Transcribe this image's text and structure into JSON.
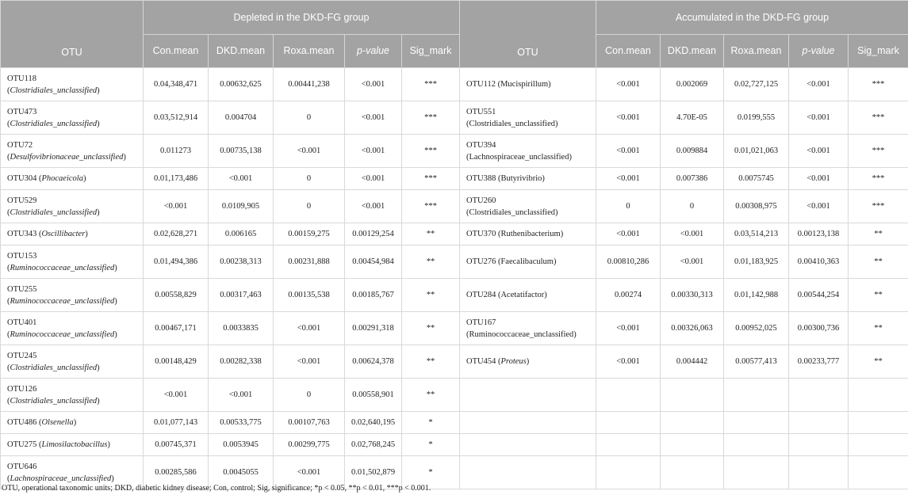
{
  "header": {
    "group_left": "Depleted in the DKD-FG group",
    "group_right": "Accumulated in the DKD-FG group",
    "columns": [
      "OTU",
      "Con.mean",
      "DKD.mean",
      "Roxa.mean",
      "p-value",
      "Sig_mark"
    ]
  },
  "rows": [
    {
      "tall": true,
      "left": {
        "id": "OTU118",
        "tax": "Clostridiales_unclassified",
        "italic": true,
        "wrap": true,
        "con": "0.04,348,471",
        "dkd": "0.00632,625",
        "roxa": "0.00441,238",
        "p": "<0.001",
        "sig": "***"
      },
      "right": {
        "id": "OTU112",
        "tax": "Mucispirillum",
        "italic": false,
        "wrap": false,
        "con": "<0.001",
        "dkd": "0.002069",
        "roxa": "0.02,727,125",
        "p": "<0.001",
        "sig": "***"
      }
    },
    {
      "tall": true,
      "left": {
        "id": "OTU473",
        "tax": "Clostridiales_unclassified",
        "italic": true,
        "wrap": true,
        "con": "0.03,512,914",
        "dkd": "0.004704",
        "roxa": "0",
        "p": "<0.001",
        "sig": "***"
      },
      "right": {
        "id": "OTU551",
        "tax": "Clostridiales_unclassified",
        "italic": false,
        "wrap": true,
        "con": "<0.001",
        "dkd": "4.70E-05",
        "roxa": "0.0199,555",
        "p": "<0.001",
        "sig": "***"
      }
    },
    {
      "tall": true,
      "left": {
        "id": "OTU72",
        "tax": "Desulfovibrionaceae_unclassified",
        "italic": true,
        "wrap": true,
        "con": "0.011273",
        "dkd": "0.00735,138",
        "roxa": "<0.001",
        "p": "<0.001",
        "sig": "***"
      },
      "right": {
        "id": "OTU394",
        "tax": "Lachnospiraceae_unclassified",
        "italic": false,
        "wrap": true,
        "con": "<0.001",
        "dkd": "0.009884",
        "roxa": "0.01,021,063",
        "p": "<0.001",
        "sig": "***"
      }
    },
    {
      "tall": false,
      "left": {
        "id": "OTU304",
        "tax": "Phocaeicola",
        "italic": true,
        "wrap": false,
        "con": "0.01,173,486",
        "dkd": "<0.001",
        "roxa": "0",
        "p": "<0.001",
        "sig": "***"
      },
      "right": {
        "id": "OTU388",
        "tax": "Butyrivibrio",
        "italic": false,
        "wrap": false,
        "con": "<0.001",
        "dkd": "0.007386",
        "roxa": "0.0075745",
        "p": "<0.001",
        "sig": "***"
      }
    },
    {
      "tall": true,
      "left": {
        "id": "OTU529",
        "tax": "Clostridiales_unclassified",
        "italic": true,
        "wrap": true,
        "con": "<0.001",
        "dkd": "0.0109,905",
        "roxa": "0",
        "p": "<0.001",
        "sig": "***"
      },
      "right": {
        "id": "OTU260",
        "tax": "Clostridiales_unclassified",
        "italic": false,
        "wrap": true,
        "con": "0",
        "dkd": "0",
        "roxa": "0.00308,975",
        "p": "<0.001",
        "sig": "***"
      }
    },
    {
      "tall": false,
      "left": {
        "id": "OTU343",
        "tax": "Oscillibacter",
        "italic": true,
        "wrap": false,
        "con": "0.02,628,271",
        "dkd": "0.006165",
        "roxa": "0.00159,275",
        "p": "0.00129,254",
        "sig": "**"
      },
      "right": {
        "id": "OTU370",
        "tax": "Ruthenibacterium",
        "italic": false,
        "wrap": false,
        "con": "<0.001",
        "dkd": "<0.001",
        "roxa": "0.03,514,213",
        "p": "0.00123,138",
        "sig": "**"
      }
    },
    {
      "tall": true,
      "left": {
        "id": "OTU153",
        "tax": "Ruminococcaceae_unclassified",
        "italic": true,
        "wrap": true,
        "con": "0.01,494,386",
        "dkd": "0.00238,313",
        "roxa": "0.00231,888",
        "p": "0.00454,984",
        "sig": "**"
      },
      "right": {
        "id": "OTU276",
        "tax": "Faecalibaculum",
        "italic": false,
        "wrap": false,
        "con": "0.00810,286",
        "dkd": "<0.001",
        "roxa": "0.01,183,925",
        "p": "0.00410,363",
        "sig": "**"
      }
    },
    {
      "tall": true,
      "left": {
        "id": "OTU255",
        "tax": "Ruminococcaceae_unclassified",
        "italic": true,
        "wrap": true,
        "con": "0.00558,829",
        "dkd": "0.00317,463",
        "roxa": "0.00135,538",
        "p": "0.00185,767",
        "sig": "**"
      },
      "right": {
        "id": "OTU284",
        "tax": "Acetatifactor",
        "italic": false,
        "wrap": false,
        "con": "0.00274",
        "dkd": "0.00330,313",
        "roxa": "0.01,142,988",
        "p": "0.00544,254",
        "sig": "**"
      }
    },
    {
      "tall": true,
      "left": {
        "id": "OTU401",
        "tax": "Ruminococcaceae_unclassified",
        "italic": true,
        "wrap": true,
        "con": "0.00467,171",
        "dkd": "0.0033835",
        "roxa": "<0.001",
        "p": "0.00291,318",
        "sig": "**"
      },
      "right": {
        "id": "OTU167",
        "tax": "Ruminococcaceae_unclassified",
        "italic": false,
        "wrap": true,
        "con": "<0.001",
        "dkd": "0.00326,063",
        "roxa": "0.00952,025",
        "p": "0.00300,736",
        "sig": "**"
      }
    },
    {
      "tall": true,
      "left": {
        "id": "OTU245",
        "tax": "Clostridiales_unclassified",
        "italic": true,
        "wrap": true,
        "con": "0.00148,429",
        "dkd": "0.00282,338",
        "roxa": "<0.001",
        "p": "0.00624,378",
        "sig": "**"
      },
      "right": {
        "id": "OTU454",
        "tax": "Proteus",
        "italic": true,
        "wrap": false,
        "con": "<0.001",
        "dkd": "0.004442",
        "roxa": "0.00577,413",
        "p": "0.00233,777",
        "sig": "**"
      }
    },
    {
      "tall": true,
      "left": {
        "id": "OTU126",
        "tax": "Clostridiales_unclassified",
        "italic": true,
        "wrap": true,
        "con": "<0.001",
        "dkd": "<0.001",
        "roxa": "0",
        "p": "0.00558,901",
        "sig": "**"
      },
      "right": null
    },
    {
      "tall": false,
      "left": {
        "id": "OTU486",
        "tax": "Olsenella",
        "italic": true,
        "wrap": false,
        "con": "0.01,077,143",
        "dkd": "0.00533,775",
        "roxa": "0.00107,763",
        "p": "0.02,640,195",
        "sig": "*"
      },
      "right": null
    },
    {
      "tall": false,
      "left": {
        "id": "OTU275",
        "tax": "Limosilactobacillus",
        "italic": true,
        "wrap": false,
        "con": "0.00745,371",
        "dkd": "0.0053945",
        "roxa": "0.00299,775",
        "p": "0.02,768,245",
        "sig": "*"
      },
      "right": null
    },
    {
      "tall": true,
      "left": {
        "id": "OTU646",
        "tax": "Lachnospiraceae_unclassified",
        "italic": true,
        "wrap": true,
        "con": "0.00285,586",
        "dkd": "0.0045055",
        "roxa": "<0.001",
        "p": "0.01,502,879",
        "sig": "*"
      },
      "right": null
    }
  ],
  "footnote": "OTU, operational taxonomic units; DKD, diabetic kidney disease; Con, control; Sig, significance; *p < 0.05, **p < 0.01, ***p < 0.001."
}
